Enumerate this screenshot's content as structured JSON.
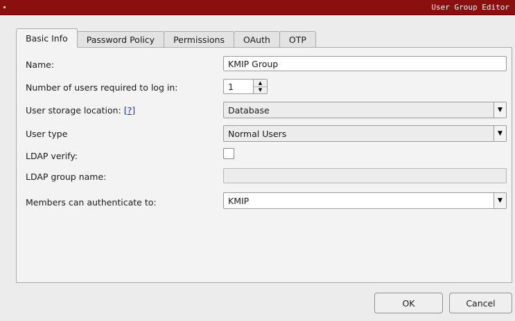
{
  "window": {
    "title": "User Group Editor"
  },
  "tabs": [
    {
      "label": "Basic Info",
      "active": true
    },
    {
      "label": "Password Policy"
    },
    {
      "label": "Permissions"
    },
    {
      "label": "OAuth"
    },
    {
      "label": "OTP"
    }
  ],
  "form": {
    "name_label": "Name:",
    "name_value": "KMIP Group",
    "users_required_label": "Number of users required to log in:",
    "users_required_value": "1",
    "storage_label": "User storage location:",
    "storage_help": "[?]",
    "storage_value": "Database",
    "user_type_label": "User type",
    "user_type_value": "Normal Users",
    "ldap_verify_label": "LDAP verify:",
    "ldap_verify_checked": false,
    "ldap_group_label": "LDAP group name:",
    "ldap_group_value": "",
    "members_auth_label": "Members can authenticate to:",
    "members_auth_value": "KMIP"
  },
  "buttons": {
    "ok": "OK",
    "cancel": "Cancel"
  },
  "colors": {
    "titlebar": "#8b0f0f",
    "link": "#1133cc"
  }
}
